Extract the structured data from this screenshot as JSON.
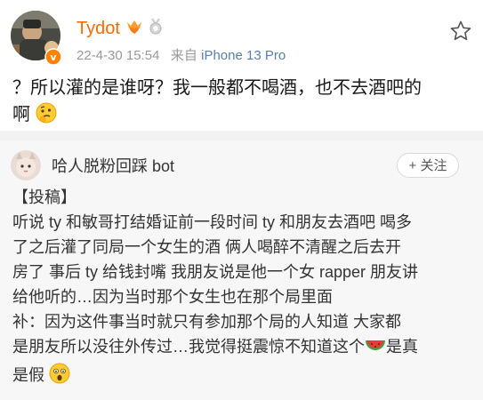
{
  "post": {
    "username": "Tydot",
    "badges": [
      "crown-heart-badge",
      "medal-badge"
    ],
    "date": "22-4-30 15:54",
    "source_prefix": "来自",
    "device": "iPhone 13 Pro",
    "text_line1": "？所以灌的是谁呀？我一般都不喝酒，也不去酒吧的",
    "text_line2": "啊",
    "text_emoji": "thinking-face-emoji"
  },
  "repost": {
    "author": "哈人脱粉回踩 bot",
    "follow_label": "+ 关注",
    "lines": [
      "【投稿】",
      "听说 ty 和敏哥打结婚证前一段时间 ty 和朋友去酒吧 喝多",
      "了之后灌了同局一个女生的酒 俩人喝醉不清醒之后去开",
      "房了 事后 ty 给钱封嘴 我朋友说是他一个女 rapper 朋友讲",
      "给他听的…因为当时那个女生也在那个局里面",
      "补：因为这件事当时就只有参加那个局的人知道 大家都",
      "是朋友所以没往外传过…我觉得挺震惊不知道这个"
    ],
    "last_line_suffix": "是真",
    "last_line": "是假",
    "emojis": [
      "watermelon-emoji",
      "astonished-face-emoji"
    ]
  },
  "colors": {
    "username": "#ff6a00",
    "device": "#5b7ea6",
    "meta": "#9a9a9a",
    "repost_bg": "#f7f7f7"
  }
}
